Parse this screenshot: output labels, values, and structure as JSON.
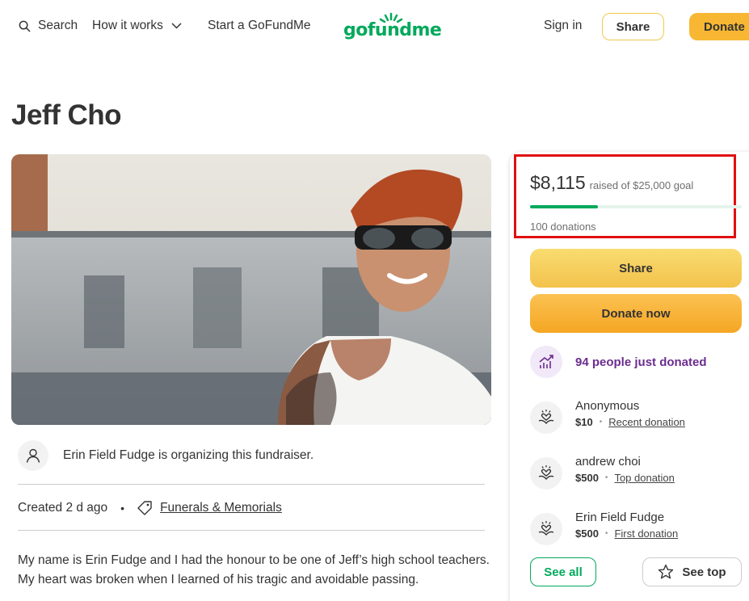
{
  "nav": {
    "search": "Search",
    "how_it_works": "How it works",
    "start": "Start a GoFundMe",
    "logo": "gofundme",
    "sign_in": "Sign in",
    "share": "Share",
    "donate": "Donate"
  },
  "page": {
    "title": "Jeff Cho"
  },
  "organizer": {
    "text": "Erin Field Fudge is organizing this fundraiser."
  },
  "meta": {
    "created": "Created 2 d ago",
    "dot": "•",
    "category": "Funerals & Memorials"
  },
  "story": {
    "text": "My name is Erin Fudge and I had the honour to be one of Jeff’s high school teachers. My heart was broken when I learned of his tragic and avoidable passing."
  },
  "donation_card": {
    "raised": "$8,115",
    "goal_text": "raised of $25,000 goal",
    "progress_fraction": 0.32,
    "donation_count": "100 donations",
    "share_label": "Share",
    "donate_label": "Donate now",
    "trend_text": "94 people just donated",
    "donors": [
      {
        "name": "Anonymous",
        "amount": "$10",
        "tag": "Recent donation"
      },
      {
        "name": "andrew choi",
        "amount": "$500",
        "tag": "Top donation"
      },
      {
        "name": "Erin Field Fudge",
        "amount": "$500",
        "tag": "First donation"
      }
    ],
    "see_all": "See all",
    "see_top": "See top"
  },
  "colors": {
    "brand_green": "#02a95c",
    "donate_orange": "#f5a623",
    "share_yellow": "#f3c24c",
    "trend_purple": "#6b2d8e",
    "highlight_red": "#e01010"
  },
  "icons": [
    "search-icon",
    "chevron-down-icon",
    "person-icon",
    "tag-icon",
    "trend-up-icon",
    "donation-hand-heart-icon",
    "star-icon"
  ]
}
